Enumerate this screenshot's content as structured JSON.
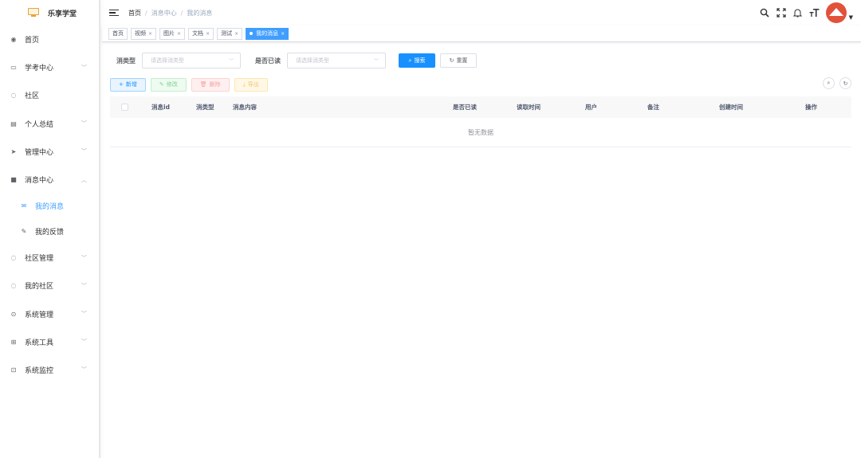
{
  "app": {
    "title": "乐享学堂"
  },
  "sidebar": {
    "items": [
      {
        "label": "首页",
        "icon": "dashboard-icon",
        "glyph": "◉",
        "arrow": ""
      },
      {
        "label": "学考中心",
        "icon": "monitor-icon",
        "glyph": "▭",
        "arrow": "﹀"
      },
      {
        "label": "社区",
        "icon": "community-icon",
        "glyph": "◌",
        "arrow": ""
      },
      {
        "label": "个人总结",
        "icon": "notebook-icon",
        "glyph": "▤",
        "arrow": "﹀"
      },
      {
        "label": "管理中心",
        "icon": "send-icon",
        "glyph": "➤",
        "arrow": "﹀"
      },
      {
        "label": "消息中心",
        "icon": "message-icon",
        "glyph": "■",
        "arrow": "︿"
      }
    ],
    "submenu": [
      {
        "label": "我的消息",
        "icon": "mail-icon",
        "glyph": "✉",
        "active": true
      },
      {
        "label": "我的反馈",
        "icon": "edit-icon",
        "glyph": "✎",
        "active": false
      }
    ],
    "items_after": [
      {
        "label": "社区管理",
        "icon": "community-manage-icon",
        "glyph": "◌",
        "arrow": "﹀"
      },
      {
        "label": "我的社区",
        "icon": "my-community-icon",
        "glyph": "◌",
        "arrow": "﹀"
      },
      {
        "label": "系统管理",
        "icon": "settings-icon",
        "glyph": "⊙",
        "arrow": "﹀"
      },
      {
        "label": "系统工具",
        "icon": "toolbox-icon",
        "glyph": "⊞",
        "arrow": "﹀"
      },
      {
        "label": "系统监控",
        "icon": "monitor-chart-icon",
        "glyph": "⊡",
        "arrow": "﹀"
      }
    ]
  },
  "header": {
    "breadcrumb": [
      "首页",
      "消息中心",
      "我的消息"
    ],
    "breadcrumb_sep": "/"
  },
  "tags": [
    {
      "label": "首页",
      "closable": false,
      "active": false
    },
    {
      "label": "视频",
      "closable": true,
      "active": false
    },
    {
      "label": "图片",
      "closable": true,
      "active": false
    },
    {
      "label": "文档",
      "closable": true,
      "active": false
    },
    {
      "label": "测试",
      "closable": true,
      "active": false
    },
    {
      "label": "我的消息",
      "closable": true,
      "active": true
    }
  ],
  "search": {
    "type_label": "消类型",
    "type_placeholder": "请选择消类型",
    "read_label": "是否已读",
    "read_placeholder": "请选择消类型",
    "search_btn": "搜索",
    "reset_btn": "重置"
  },
  "toolbar": {
    "add": "新增",
    "edit": "修改",
    "delete": "删除",
    "export": "导出"
  },
  "table": {
    "columns": [
      "消息id",
      "消类型",
      "消息内容",
      "是否已读",
      "读取时间",
      "用户",
      "备注",
      "创建时间",
      "操作"
    ],
    "empty_text": "暂无数据"
  },
  "colors": {
    "primary": "#1890ff",
    "active_menu": "#409eff"
  }
}
